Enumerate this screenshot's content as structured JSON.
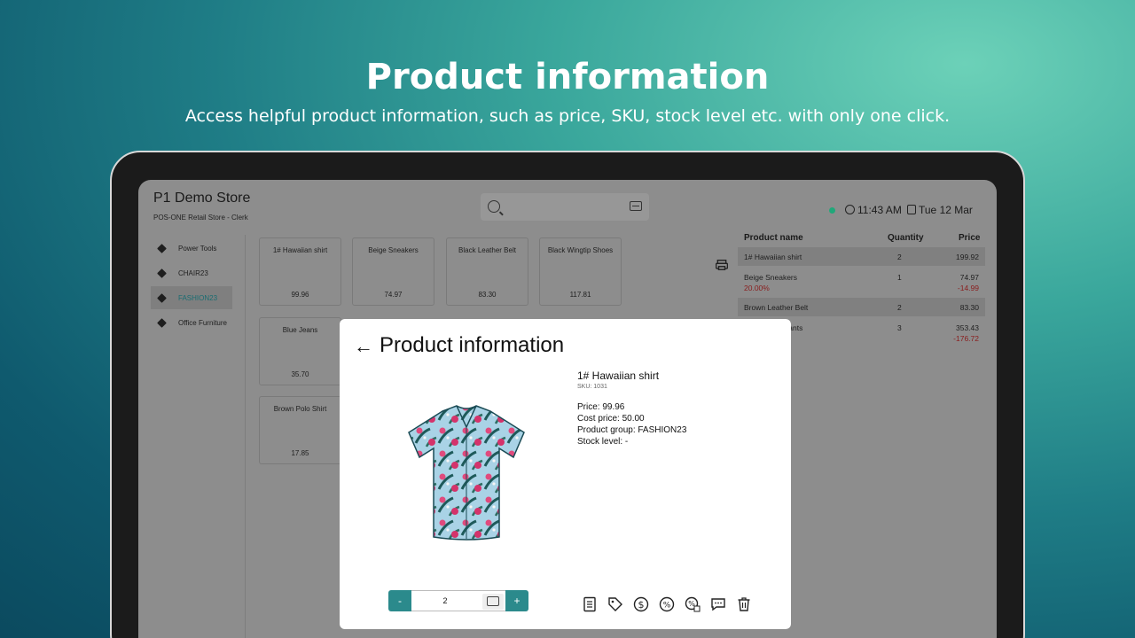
{
  "hero": {
    "title": "Product information",
    "subtitle": "Access helpful product information, such as price, SKU, stock level etc. with only one click."
  },
  "header": {
    "store_name": "P1 Demo Store",
    "store_sub": "POS-ONE Retail Store - Clerk",
    "time": "11:43 AM",
    "date": "Tue 12 Mar"
  },
  "sidebar": {
    "items": [
      {
        "label": "Power Tools"
      },
      {
        "label": "CHAIR23"
      },
      {
        "label": "FASHION23"
      },
      {
        "label": "Office Furniture"
      }
    ]
  },
  "products": [
    {
      "name": "1# Hawaiian shirt",
      "price": "99.96"
    },
    {
      "name": "Beige Sneakers",
      "price": "74.97"
    },
    {
      "name": "Black Leather Belt",
      "price": "83.30"
    },
    {
      "name": "Black Wingtip Shoes",
      "price": "117.81"
    },
    {
      "name": "Blue Jeans",
      "price": "35.70"
    },
    {
      "name": "Brown Polo Shirt",
      "price": "17.85"
    }
  ],
  "cart": {
    "headers": {
      "name": "Product name",
      "quantity": "Quantity",
      "price": "Price"
    },
    "rows": [
      {
        "name": "1# Hawaiian shirt",
        "qty": "2",
        "price": "199.92",
        "discount_pct": "",
        "discount": ""
      },
      {
        "name": "Beige Sneakers",
        "qty": "1",
        "price": "74.97",
        "discount_pct": "20.00%",
        "discount": "-14.99"
      },
      {
        "name": "Brown Leather Belt",
        "qty": "2",
        "price": "83.30",
        "discount_pct": "",
        "discount": ""
      },
      {
        "name": "y Pants",
        "qty": "3",
        "price": "353.43",
        "discount_pct": "",
        "discount": "-176.72"
      }
    ]
  },
  "modal": {
    "title": "Product information",
    "product_name": "1# Hawaiian shirt",
    "sku": "SKU: 1031",
    "price": "Price: 99.96",
    "cost_price": "Cost price: 50.00",
    "product_group": "Product group: FASHION23",
    "stock_level": "Stock level: -",
    "quantity": "2",
    "minus_label": "-",
    "plus_label": "+"
  },
  "toolbar_icons": [
    "receipt-icon",
    "price-tag-icon",
    "dollar-icon",
    "percent-icon",
    "percent-remove-icon",
    "comment-icon",
    "trash-icon"
  ],
  "colors": {
    "accent": "#2b8a8c",
    "status_online": "#20a87a",
    "discount": "#8a1c1c"
  }
}
